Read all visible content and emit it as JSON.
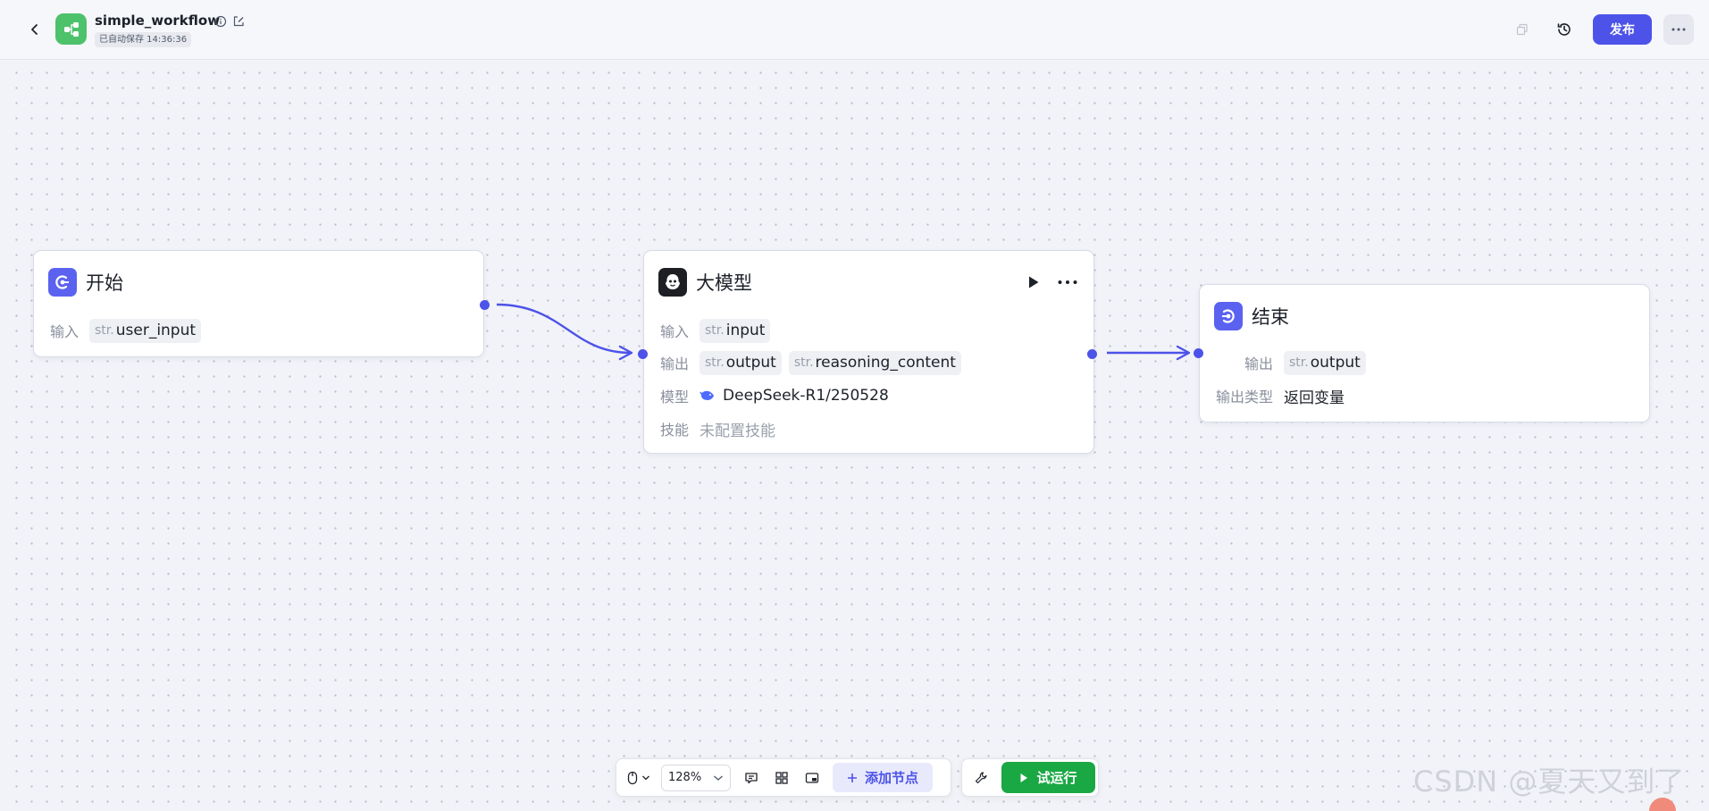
{
  "header": {
    "title": "simple_workflow",
    "autosave": "已自动保存 14:36:36",
    "publish_label": "发布"
  },
  "nodes": {
    "start": {
      "title": "开始",
      "input_label": "输入",
      "input_type": "str.",
      "input_name": "user_input"
    },
    "llm": {
      "title": "大模型",
      "input_label": "输入",
      "input_type": "str.",
      "input_name": "input",
      "output_label": "输出",
      "outputs": [
        {
          "type": "str.",
          "name": "output"
        },
        {
          "type": "str.",
          "name": "reasoning_content"
        }
      ],
      "model_label": "模型",
      "model_value": "DeepSeek-R1/250528",
      "skill_label": "技能",
      "skill_value": "未配置技能"
    },
    "end": {
      "title": "结束",
      "output_label": "输出",
      "output_type": "str.",
      "output_name": "output",
      "output_kind_label": "输出类型",
      "output_kind_value": "返回变量"
    }
  },
  "toolbar": {
    "zoom": "128%",
    "add_node_label": "添加节点",
    "trial_run_label": "试运行"
  },
  "watermark": "CSDN @夏天又到了",
  "colors": {
    "accent": "#4d53e8",
    "run_green": "#1aa844",
    "logo_green": "#4ec26b"
  }
}
